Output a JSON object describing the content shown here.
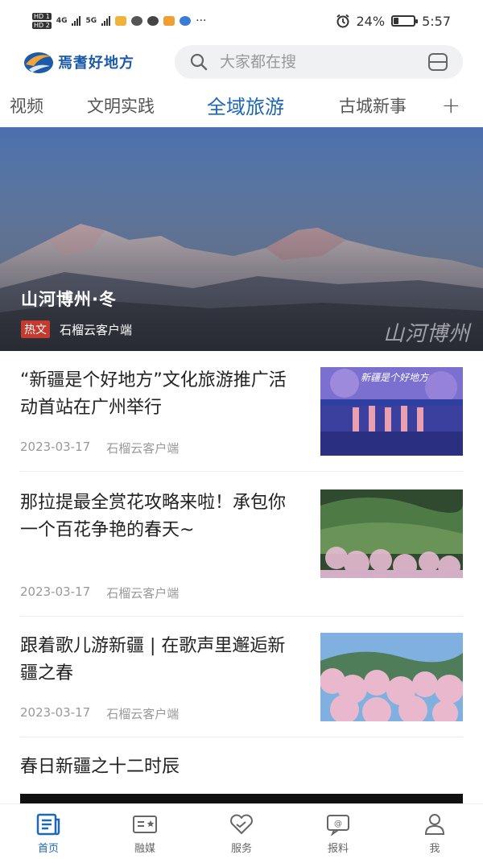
{
  "status_bar": {
    "hd1": "HD 1",
    "hd2": "HD 2",
    "net1": "4G",
    "net2": "5G",
    "more": "···",
    "battery_text": "24%",
    "battery_level": 0.24,
    "time": "5:57"
  },
  "header": {
    "logo_text": "焉耆好地方",
    "search_placeholder": "大家都在搜"
  },
  "tabs": [
    {
      "label": "视频"
    },
    {
      "label": "文明实践"
    },
    {
      "label": "全域旅游"
    },
    {
      "label": "古城新事"
    }
  ],
  "tabs_add": "+",
  "hero": {
    "title": "山河博州·冬",
    "badge": "热文",
    "source": "石榴云客户端",
    "watermark": "山河博州"
  },
  "news": [
    {
      "title": "“新疆是个好地方”文化旅游推广活动首站在广州举行",
      "date": "2023-03-17",
      "source": "石榴云客户端",
      "thumb_text": "新疆是个好地方"
    },
    {
      "title": "那拉提最全赏花攻略来啦！承包你一个百花争艳的春天~",
      "date": "2023-03-17",
      "source": "石榴云客户端"
    },
    {
      "title": "跟着歌儿游新疆 | 在歌声里邂逅新疆之春",
      "date": "2023-03-17",
      "source": "石榴云客户端"
    },
    {
      "title": "春日新疆之十二时辰"
    }
  ],
  "bottom_nav": [
    {
      "label": "首页",
      "icon": "home-doc-icon"
    },
    {
      "label": "融媒",
      "icon": "media-card-icon"
    },
    {
      "label": "服务",
      "icon": "heart-service-icon"
    },
    {
      "label": "报料",
      "icon": "report-chat-icon"
    },
    {
      "label": "我",
      "icon": "user-icon"
    }
  ],
  "colors": {
    "accent": "#1d66b8",
    "badge": "#c43a2f"
  }
}
